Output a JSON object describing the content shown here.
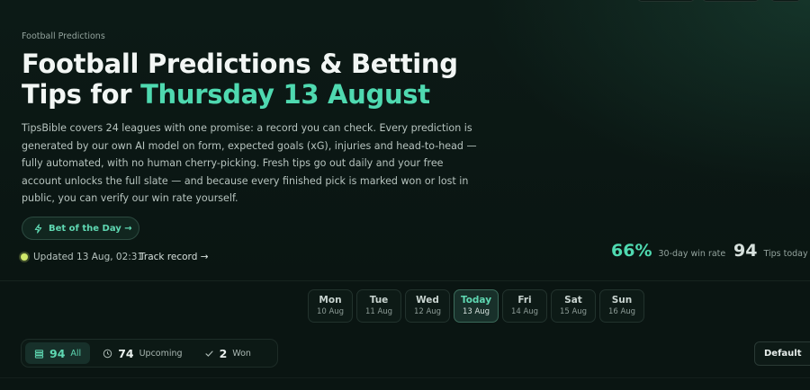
{
  "breadcrumb": "Football Predictions",
  "title": {
    "line1": "Football Predictions & Betting",
    "prefix": "Tips for ",
    "date": "Thursday 13 August"
  },
  "intro": "TipsBible covers 24 leagues with one promise: a record you can check. Every prediction is generated by our own AI model on form, expected goals (xG), injuries and head-to-head — fully automated, with no human cherry-picking. Fresh tips go out daily and your free account unlocks the full slate — and because every finished pick is marked won or lost in public, you can verify our win rate yourself.",
  "bet_of_day": {
    "label": "Bet of the Day →",
    "icon": "lightning-icon"
  },
  "updated": "Updated 13 Aug, 02:31",
  "track_record": "Track record →",
  "stats": {
    "win_rate": {
      "value": "66%",
      "label": "30-day win rate"
    },
    "tips_today": {
      "value": "94",
      "label": "Tips today"
    }
  },
  "days": [
    {
      "name": "Mon",
      "date": "10 Aug"
    },
    {
      "name": "Tue",
      "date": "11 Aug"
    },
    {
      "name": "Wed",
      "date": "12 Aug"
    },
    {
      "name": "Today",
      "date": "13 Aug"
    },
    {
      "name": "Fri",
      "date": "14 Aug"
    },
    {
      "name": "Sat",
      "date": "15 Aug"
    },
    {
      "name": "Sun",
      "date": "16 Aug"
    }
  ],
  "filters": {
    "all": {
      "count": "94",
      "label": "All",
      "icon": "list-icon"
    },
    "upcoming": {
      "count": "74",
      "label": "Upcoming",
      "icon": "clock-icon"
    },
    "won": {
      "count": "2",
      "label": "Won",
      "icon": "check-icon"
    }
  },
  "sort": {
    "label": "Default"
  },
  "colors": {
    "accent": "#4fd9b0",
    "background": "#0a1512",
    "live_dot": "#cfe86a"
  }
}
